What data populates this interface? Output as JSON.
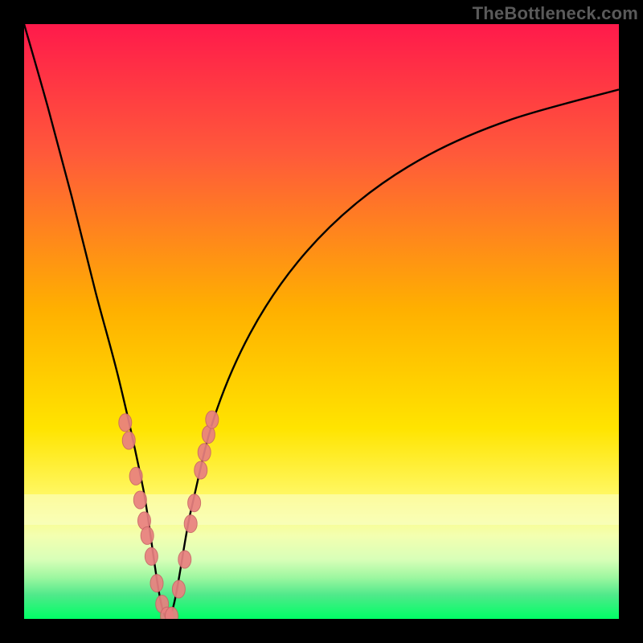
{
  "watermark": "TheBottleneck.com",
  "colors": {
    "bg_black": "#000000",
    "grad_top": "#ff1a4b",
    "grad_mid": "#ffd900",
    "grad_band_light": "#f6ff99",
    "grad_bottom_band": "#21e07c",
    "grad_bottom": "#00ff66",
    "curve": "#000000",
    "dot_fill": "#e98080",
    "dot_stroke": "#c96767"
  },
  "chart_data": {
    "type": "line",
    "title": "",
    "xlabel": "",
    "ylabel": "",
    "xlim": [
      0,
      100
    ],
    "ylim": [
      0,
      100
    ],
    "note": "V-shaped bottleneck curve; minimum near x≈24, y≈0. No axis ticks or numeric labels are rendered in the image — values below are visually estimated positions in 0-100 plot coordinates.",
    "series": [
      {
        "name": "bottleneck-curve",
        "x": [
          0,
          4,
          8,
          12,
          16,
          20,
          24,
          28,
          32,
          38,
          46,
          56,
          68,
          82,
          100
        ],
        "y": [
          100,
          86,
          71,
          55,
          40,
          22,
          0,
          18,
          34,
          48,
          60,
          70,
          78,
          84,
          89
        ]
      }
    ],
    "scatter_overlay": {
      "name": "highlight-dots",
      "points": [
        {
          "x": 17.0,
          "y": 33.0
        },
        {
          "x": 17.6,
          "y": 30.0
        },
        {
          "x": 18.8,
          "y": 24.0
        },
        {
          "x": 19.5,
          "y": 20.0
        },
        {
          "x": 20.2,
          "y": 16.5
        },
        {
          "x": 20.7,
          "y": 14.0
        },
        {
          "x": 21.4,
          "y": 10.5
        },
        {
          "x": 22.3,
          "y": 6.0
        },
        {
          "x": 23.2,
          "y": 2.5
        },
        {
          "x": 24.0,
          "y": 0.5
        },
        {
          "x": 24.8,
          "y": 0.5
        },
        {
          "x": 26.0,
          "y": 5.0
        },
        {
          "x": 27.0,
          "y": 10.0
        },
        {
          "x": 28.0,
          "y": 16.0
        },
        {
          "x": 28.6,
          "y": 19.5
        },
        {
          "x": 29.7,
          "y": 25.0
        },
        {
          "x": 30.3,
          "y": 28.0
        },
        {
          "x": 31.0,
          "y": 31.0
        },
        {
          "x": 31.6,
          "y": 33.5
        }
      ]
    }
  }
}
